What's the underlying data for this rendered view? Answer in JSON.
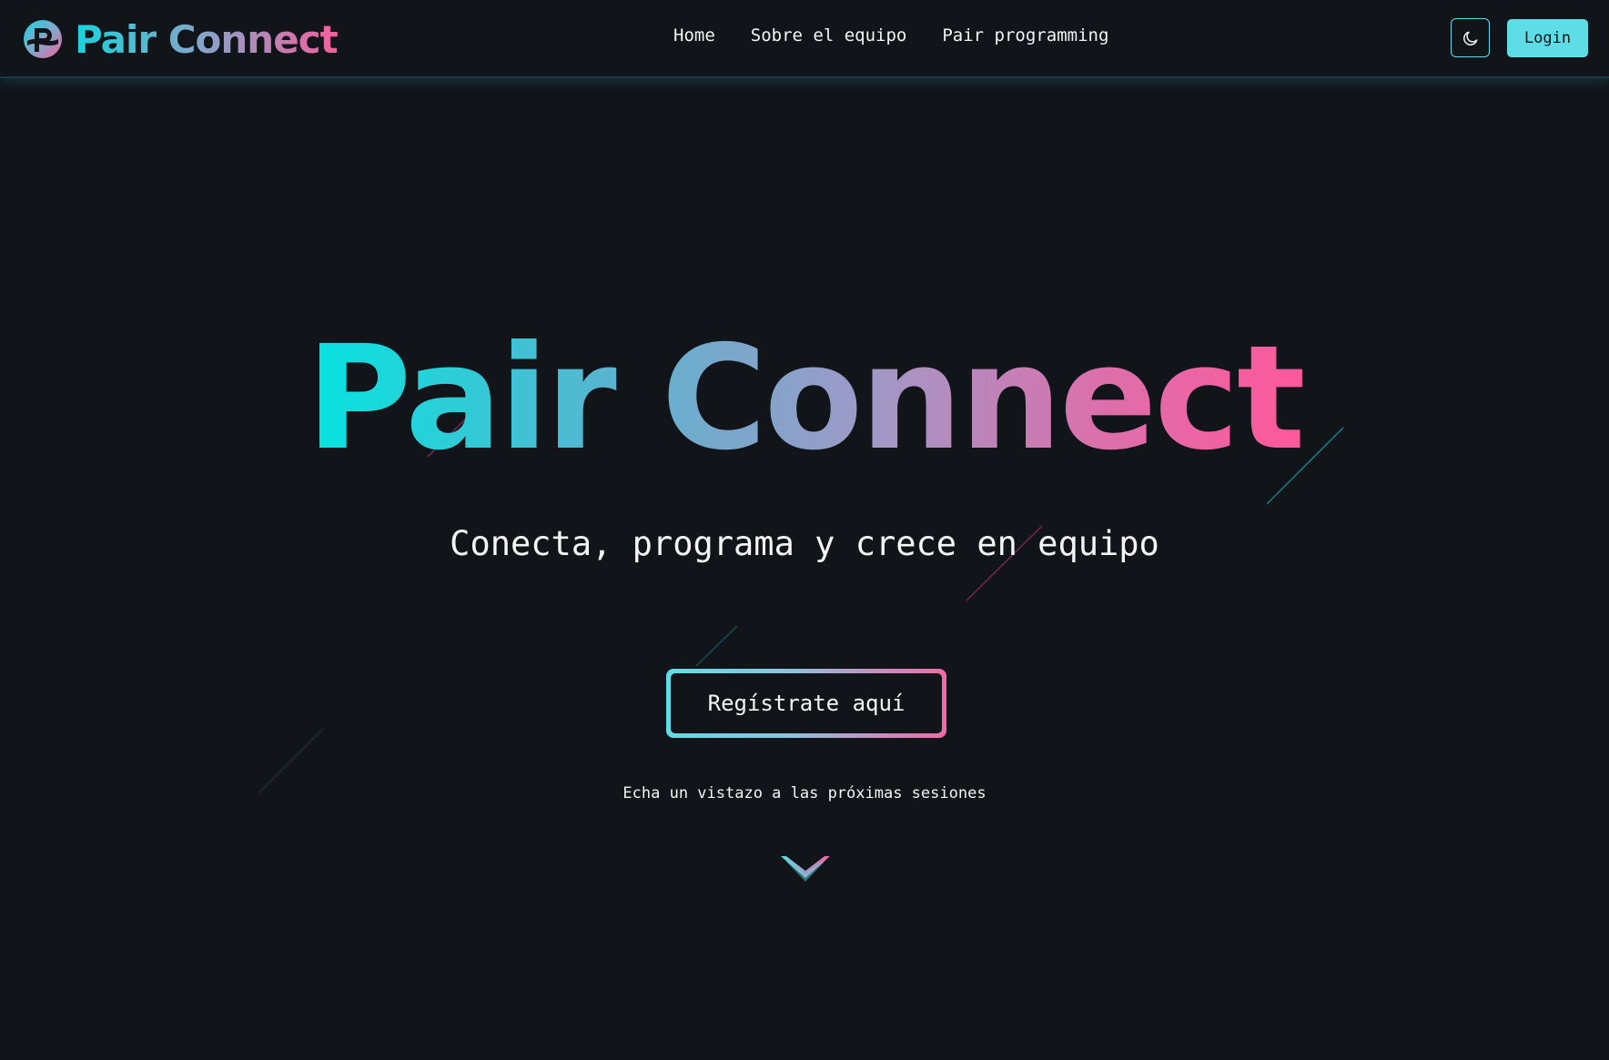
{
  "brand": {
    "name": "Pair Connect",
    "logo_icon": "pair-connect-logo"
  },
  "nav": {
    "links": [
      "Home",
      "Sobre el equipo",
      "Pair programming"
    ],
    "theme_toggle_icon": "moon-icon",
    "login_label": "Login"
  },
  "hero": {
    "title": "Pair Connect",
    "subtitle": "Conecta, programa y crece en equipo",
    "register_label": "Regístrate aquí",
    "sessions_link": "Echa un vistazo a las próximas sesiones",
    "scroll_icon": "chevron-down-icon"
  },
  "colors": {
    "background": "#111418",
    "accent_cyan": "#5fdde6",
    "accent_pink": "#f45f9d",
    "text": "#f2f4f6"
  }
}
